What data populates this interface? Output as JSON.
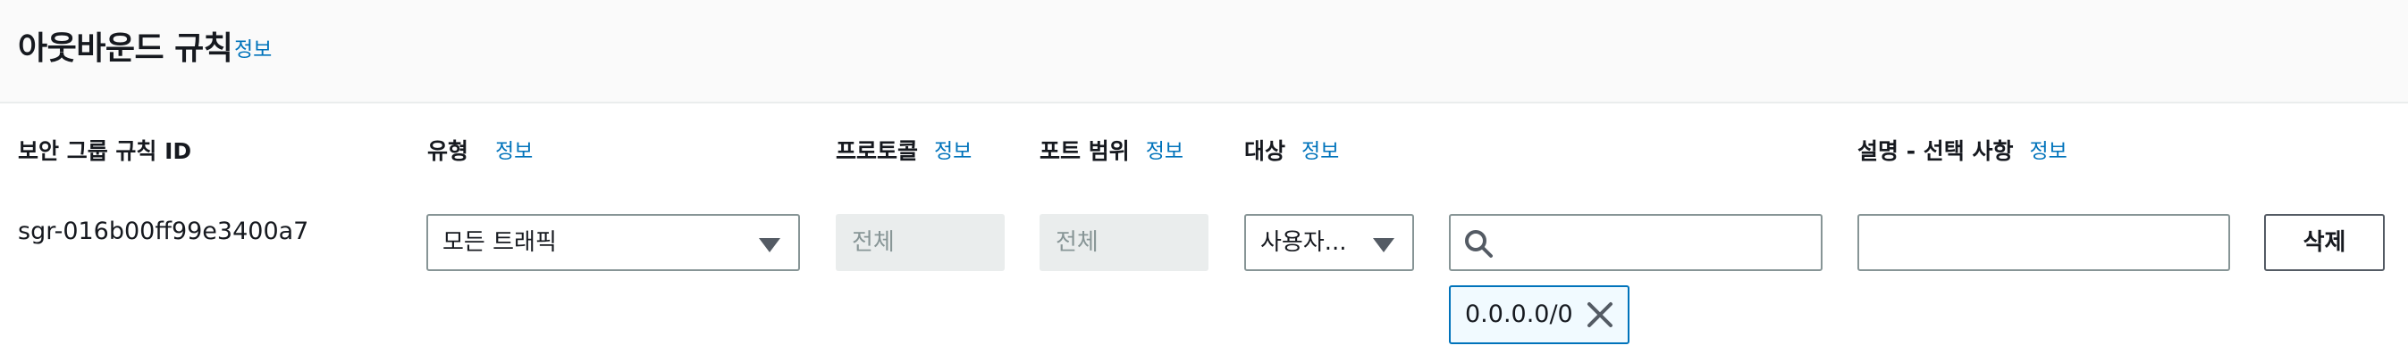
{
  "header": {
    "title": "아웃바운드 규칙",
    "info_link": "정보"
  },
  "columns": {
    "rule_id": "보안 그룹 규칙 ID",
    "type": "유형",
    "protocol": "프로토콜",
    "port_range": "포트 범위",
    "destination": "대상",
    "description": "설명 - 선택 사항",
    "info_link": "정보"
  },
  "rule": {
    "id": "sgr-016b00ff99e3400a7",
    "type_value": "모든 트래픽",
    "protocol_value": "전체",
    "port_range_value": "전체",
    "destination_type_value": "사용자...",
    "destination_search_value": "",
    "description_value": "",
    "delete_label": "삭제",
    "destination_token": "0.0.0.0/0"
  },
  "icons": {
    "type_dropdown": "caret-down-icon",
    "destination_dropdown": "caret-down-icon",
    "destination_search": "search-icon",
    "token_remove": "close-icon"
  },
  "colors": {
    "link": "#0073bb",
    "border": "#879596",
    "disabled_bg": "#eaeded",
    "token_bg": "#f1faff"
  }
}
